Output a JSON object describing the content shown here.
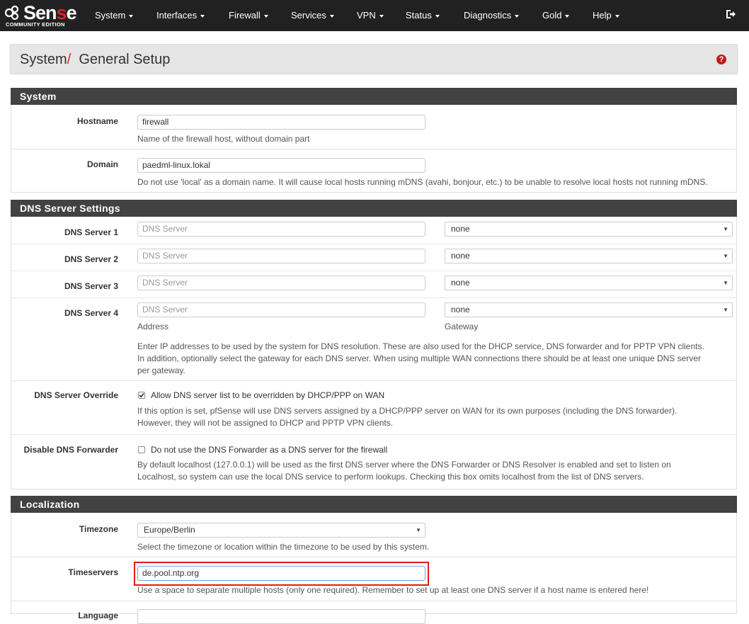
{
  "brand": {
    "logo_main_a": "Sen",
    "logo_main_b": "s",
    "logo_main_c": "e",
    "logo_sub": "COMMUNITY EDITION"
  },
  "nav": [
    "System",
    "Interfaces",
    "Firewall",
    "Services",
    "VPN",
    "Status",
    "Diagnostics",
    "Gold",
    "Help"
  ],
  "breadcrumb": {
    "parent": "System",
    "sep": "/",
    "current": "General Setup"
  },
  "help_icon": "?",
  "system": {
    "title": "System",
    "hostname": {
      "label": "Hostname",
      "value": "firewall",
      "help": "Name of the firewall host, without domain part"
    },
    "domain": {
      "label": "Domain",
      "value": "paedml-linux.lokal",
      "help": "Do not use 'local' as a domain name. It will cause local hosts running mDNS (avahi, bonjour, etc.) to be unable to resolve local hosts not running mDNS."
    }
  },
  "dns": {
    "title": "DNS Server Settings",
    "servers": [
      {
        "label": "DNS Server 1",
        "placeholder": "DNS Server",
        "gateway": "none"
      },
      {
        "label": "DNS Server 2",
        "placeholder": "DNS Server",
        "gateway": "none"
      },
      {
        "label": "DNS Server 3",
        "placeholder": "DNS Server",
        "gateway": "none"
      },
      {
        "label": "DNS Server 4",
        "placeholder": "DNS Server",
        "gateway": "none"
      }
    ],
    "address_caption": "Address",
    "gateway_caption": "Gateway",
    "help": [
      "Enter IP addresses to be used by the system for DNS resolution. These are also used for the DHCP service, DNS forwarder and for PPTP VPN clients.",
      "In addition, optionally select the gateway for each DNS server. When using multiple WAN connections there should be at least one unique DNS server",
      "per gateway."
    ],
    "override": {
      "label": "DNS Server Override",
      "checkbox": "Allow DNS server list to be overridden by DHCP/PPP on WAN",
      "help": [
        "If this option is set, pfSense will use DNS servers assigned by a DHCP/PPP server on WAN for its own purposes (including the DNS forwarder).",
        "However, they will not be assigned to DHCP and PPTP VPN clients."
      ]
    },
    "forwarder": {
      "label": "Disable DNS Forwarder",
      "checkbox": "Do not use the DNS Forwarder as a DNS server for the firewall",
      "help": [
        "By default localhost (127.0.0.1) will be used as the first DNS server where the DNS Forwarder or DNS Resolver is enabled and set to listen on",
        "Localhost, so system can use the local DNS service to perform lookups. Checking this box omits localhost from the list of DNS servers."
      ]
    }
  },
  "localization": {
    "title": "Localization",
    "timezone": {
      "label": "Timezone",
      "value": "Europe/Berlin",
      "help": "Select the timezone or location within the timezone to be used by this system."
    },
    "timeservers": {
      "label": "Timeservers",
      "value": "de.pool.ntp.org",
      "help": "Use a space to separate multiple hosts (only one required). Remember to set up at least one DNS server if a host name is entered here!"
    },
    "language": {
      "label": "Language"
    }
  }
}
